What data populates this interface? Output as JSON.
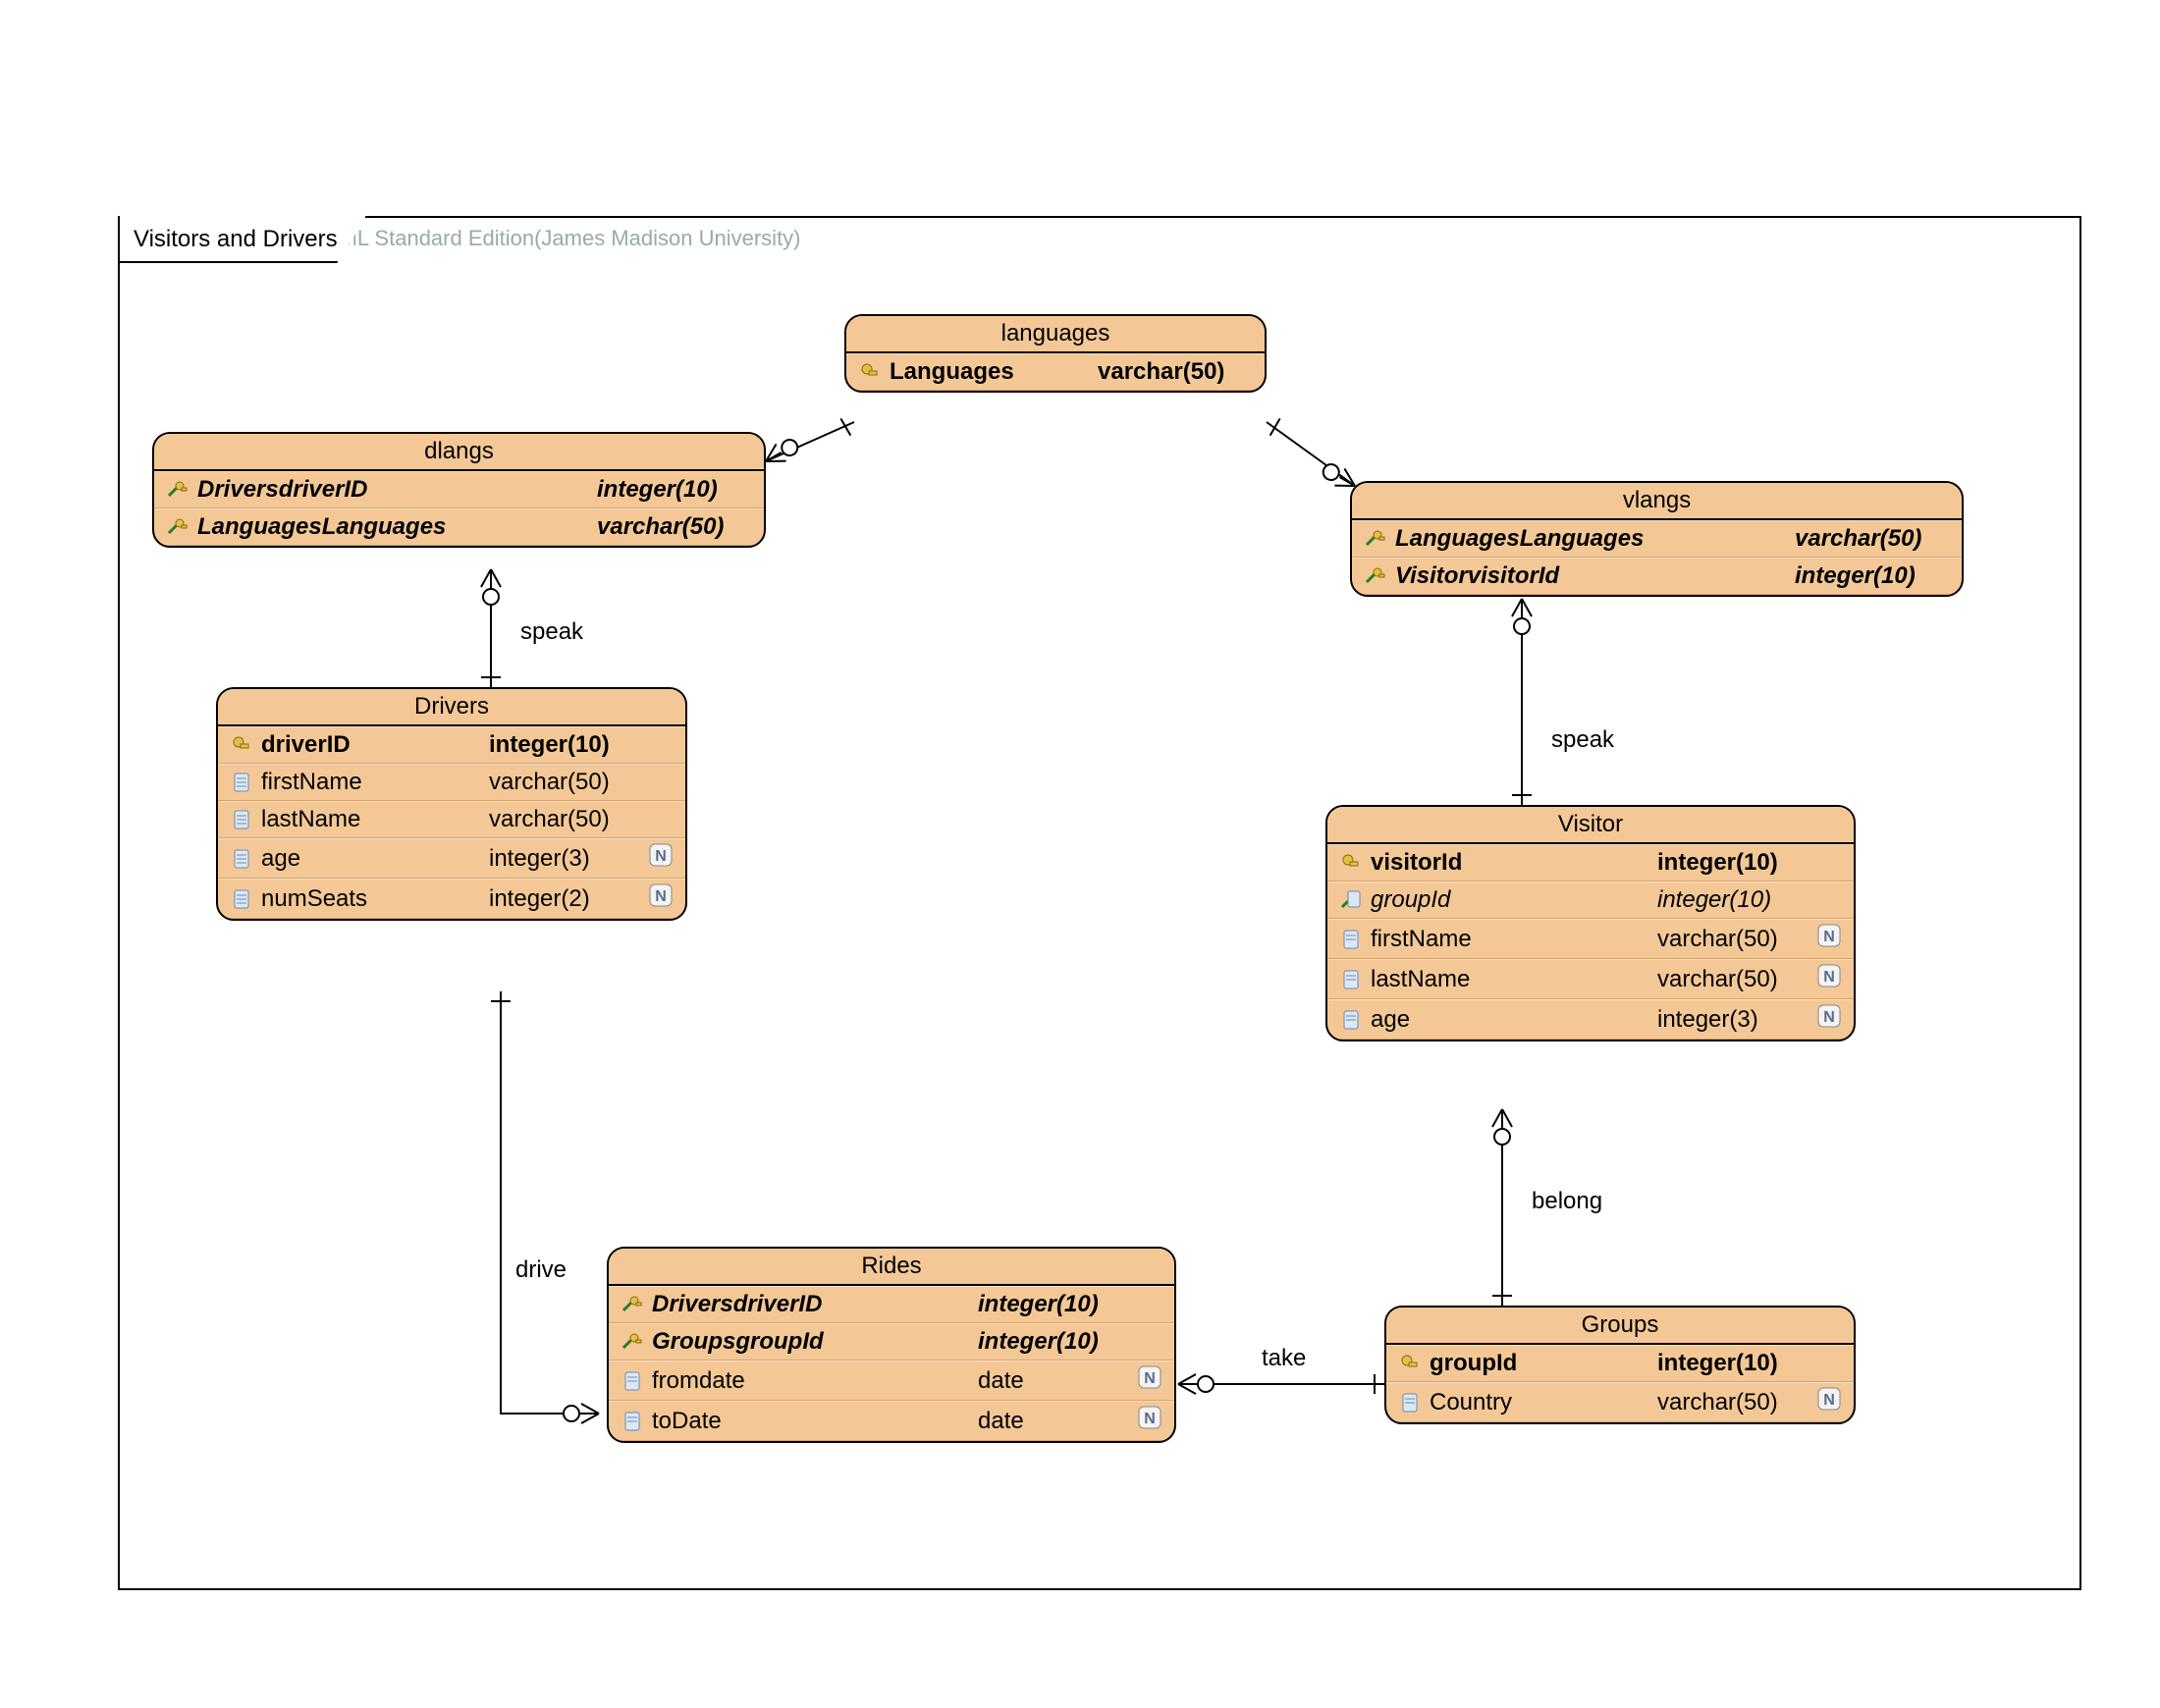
{
  "watermark": "Visual Paradigm for UML Standard Edition(James Madison University)",
  "frame_title": "Visitors and Drivers",
  "relations": {
    "speak1": "speak",
    "speak2": "speak",
    "drive": "drive",
    "take": "take",
    "belong": "belong"
  },
  "entities": {
    "languages": {
      "title": "languages",
      "rows": [
        {
          "icon": "pk",
          "name": "Languages",
          "type": "varchar(50)",
          "pk": true
        }
      ]
    },
    "dlangs": {
      "title": "dlangs",
      "rows": [
        {
          "icon": "fk",
          "name": "DriversdriverID",
          "type": "integer(10)",
          "fk": true
        },
        {
          "icon": "fk",
          "name": "LanguagesLanguages",
          "type": "varchar(50)",
          "fk": true
        }
      ]
    },
    "vlangs": {
      "title": "vlangs",
      "rows": [
        {
          "icon": "fk",
          "name": "LanguagesLanguages",
          "type": "varchar(50)",
          "fk": true
        },
        {
          "icon": "fk",
          "name": "VisitorvisitorId",
          "type": "integer(10)",
          "fk": true
        }
      ]
    },
    "drivers": {
      "title": "Drivers",
      "rows": [
        {
          "icon": "pk",
          "name": "driverID",
          "type": "integer(10)",
          "pk": true
        },
        {
          "icon": "col",
          "name": "firstName",
          "type": "varchar(50)"
        },
        {
          "icon": "col",
          "name": "lastName",
          "type": "varchar(50)"
        },
        {
          "icon": "col",
          "name": "age",
          "type": "integer(3)",
          "null": true
        },
        {
          "icon": "col",
          "name": "numSeats",
          "type": "integer(2)",
          "null": true
        }
      ]
    },
    "visitor": {
      "title": "Visitor",
      "rows": [
        {
          "icon": "pk",
          "name": "visitorId",
          "type": "integer(10)",
          "pk": true
        },
        {
          "icon": "fkcol",
          "name": "groupId",
          "type": "integer(10)",
          "fk": true
        },
        {
          "icon": "col",
          "name": "firstName",
          "type": "varchar(50)",
          "null": true
        },
        {
          "icon": "col",
          "name": "lastName",
          "type": "varchar(50)",
          "null": true
        },
        {
          "icon": "col",
          "name": "age",
          "type": "integer(3)",
          "null": true
        }
      ]
    },
    "rides": {
      "title": "Rides",
      "rows": [
        {
          "icon": "fk",
          "name": "DriversdriverID",
          "type": "integer(10)",
          "fk": true
        },
        {
          "icon": "fk",
          "name": "GroupsgroupId",
          "type": "integer(10)",
          "fk": true
        },
        {
          "icon": "col",
          "name": "fromdate",
          "type": "date",
          "null": true
        },
        {
          "icon": "col",
          "name": "toDate",
          "type": "date",
          "null": true
        }
      ]
    },
    "groups": {
      "title": "Groups",
      "rows": [
        {
          "icon": "pk",
          "name": "groupId",
          "type": "integer(10)",
          "pk": true
        },
        {
          "icon": "col",
          "name": "Country",
          "type": "varchar(50)",
          "null": true
        }
      ]
    }
  }
}
